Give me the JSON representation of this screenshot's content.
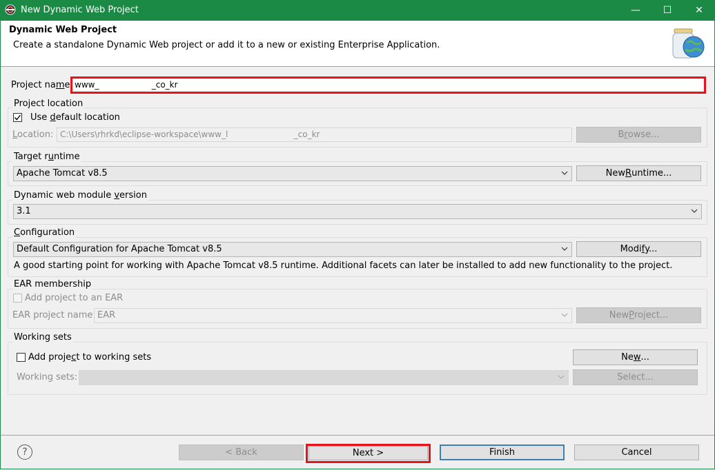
{
  "window": {
    "title": "New Dynamic Web Project",
    "controls": {
      "minimize": "—",
      "maximize": "☐",
      "close": "✕"
    }
  },
  "header": {
    "title": "Dynamic Web Project",
    "description": "Create a standalone Dynamic Web project or add it to a new or existing Enterprise Application."
  },
  "project_name": {
    "label_pre": "Project na",
    "label_mn": "m",
    "label_post": "e:",
    "value": "www_                    _co_kr"
  },
  "project_location": {
    "legend": "Project location",
    "use_default_pre": "Use ",
    "use_default_mn": "d",
    "use_default_post": "efault location",
    "use_default_checked": true,
    "location_label_pre": "",
    "location_label_mn": "L",
    "location_label_post": "ocation:",
    "location_value": "C:\\Users\\rhrkd\\eclipse-workspace\\www_l                         _co_kr",
    "browse_pre": "B",
    "browse_mn": "r",
    "browse_post": "owse..."
  },
  "target_runtime": {
    "legend_pre": "Target r",
    "legend_mn": "u",
    "legend_post": "ntime",
    "value": "Apache Tomcat v8.5",
    "new_runtime_pre": "New ",
    "new_runtime_mn": "R",
    "new_runtime_post": "untime..."
  },
  "module_version": {
    "legend_pre": "Dynamic web module ",
    "legend_mn": "v",
    "legend_post": "ersion",
    "value": "3.1"
  },
  "configuration": {
    "legend_pre": "",
    "legend_mn": "C",
    "legend_post": "onfiguration",
    "value": "Default Configuration for Apache Tomcat v8.5",
    "modify_pre": "Modi",
    "modify_mn": "f",
    "modify_post": "y...",
    "note": "A good starting point for working with Apache Tomcat v8.5 runtime. Additional facets can later be installed to add new functionality to the project."
  },
  "ear": {
    "legend": "EAR membership",
    "add_to_ear": "Add project to an EAR",
    "ear_name_label": "EAR project name:",
    "ear_name_value": "EAR",
    "new_project_pre": "New ",
    "new_project_mn": "P",
    "new_project_post": "roject..."
  },
  "working_sets": {
    "legend": "Working sets",
    "add_pre": "Add proje",
    "add_mn": "c",
    "add_post": "t to working sets",
    "new_pre": "Ne",
    "new_mn": "w",
    "new_post": "...",
    "sets_label": "Working sets:",
    "select_label": "Select..."
  },
  "footer": {
    "help": "?",
    "back": "< Back",
    "next": "Next >",
    "finish": "Finish",
    "cancel": "Cancel"
  },
  "colors": {
    "title_bar": "#1a8a44",
    "highlight": "#e5141b",
    "default_button_border": "#3c7fb1"
  }
}
